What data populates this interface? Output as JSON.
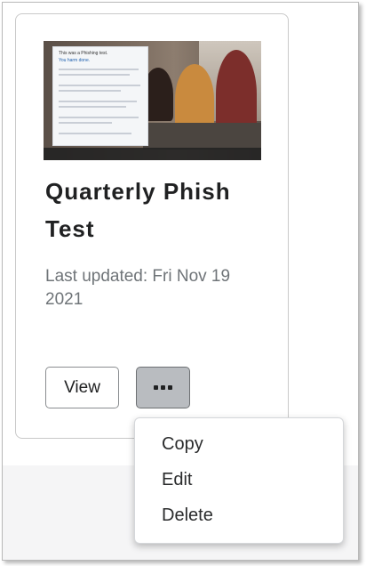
{
  "card": {
    "thumbnail_heading": "This was a Phishing test.",
    "thumbnail_subheading": "You harm done.",
    "title": "Quarterly Phish Test",
    "last_updated": "Last updated: Fri Nov 19 2021",
    "view_label": "View",
    "more_icon": "ellipsis-icon"
  },
  "menu": {
    "items": [
      "Copy",
      "Edit",
      "Delete"
    ]
  }
}
